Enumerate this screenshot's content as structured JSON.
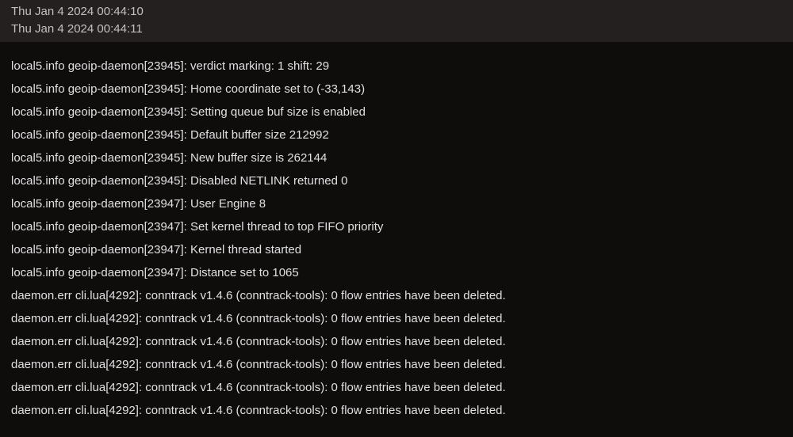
{
  "timestamps": [
    "Thu Jan 4 2024 00:44:10",
    "Thu Jan 4 2024 00:44:11"
  ],
  "log_lines": [
    "local5.info geoip-daemon[23945]: verdict marking: 1 shift: 29",
    "local5.info geoip-daemon[23945]: Home coordinate set to (-33,143)",
    "local5.info geoip-daemon[23945]: Setting queue buf size is enabled",
    "local5.info geoip-daemon[23945]: Default buffer size 212992",
    "local5.info geoip-daemon[23945]: New buffer size is 262144",
    "local5.info geoip-daemon[23945]: Disabled NETLINK returned 0",
    "local5.info geoip-daemon[23947]: User Engine 8",
    "local5.info geoip-daemon[23947]: Set kernel thread to top FIFO priority",
    "local5.info geoip-daemon[23947]: Kernel thread started",
    "local5.info geoip-daemon[23947]: Distance set to 1065",
    "daemon.err cli.lua[4292]: conntrack v1.4.6 (conntrack-tools): 0 flow entries have been deleted.",
    "daemon.err cli.lua[4292]: conntrack v1.4.6 (conntrack-tools): 0 flow entries have been deleted.",
    "daemon.err cli.lua[4292]: conntrack v1.4.6 (conntrack-tools): 0 flow entries have been deleted.",
    "daemon.err cli.lua[4292]: conntrack v1.4.6 (conntrack-tools): 0 flow entries have been deleted.",
    "daemon.err cli.lua[4292]: conntrack v1.4.6 (conntrack-tools): 0 flow entries have been deleted.",
    "daemon.err cli.lua[4292]: conntrack v1.4.6 (conntrack-tools): 0 flow entries have been deleted."
  ]
}
